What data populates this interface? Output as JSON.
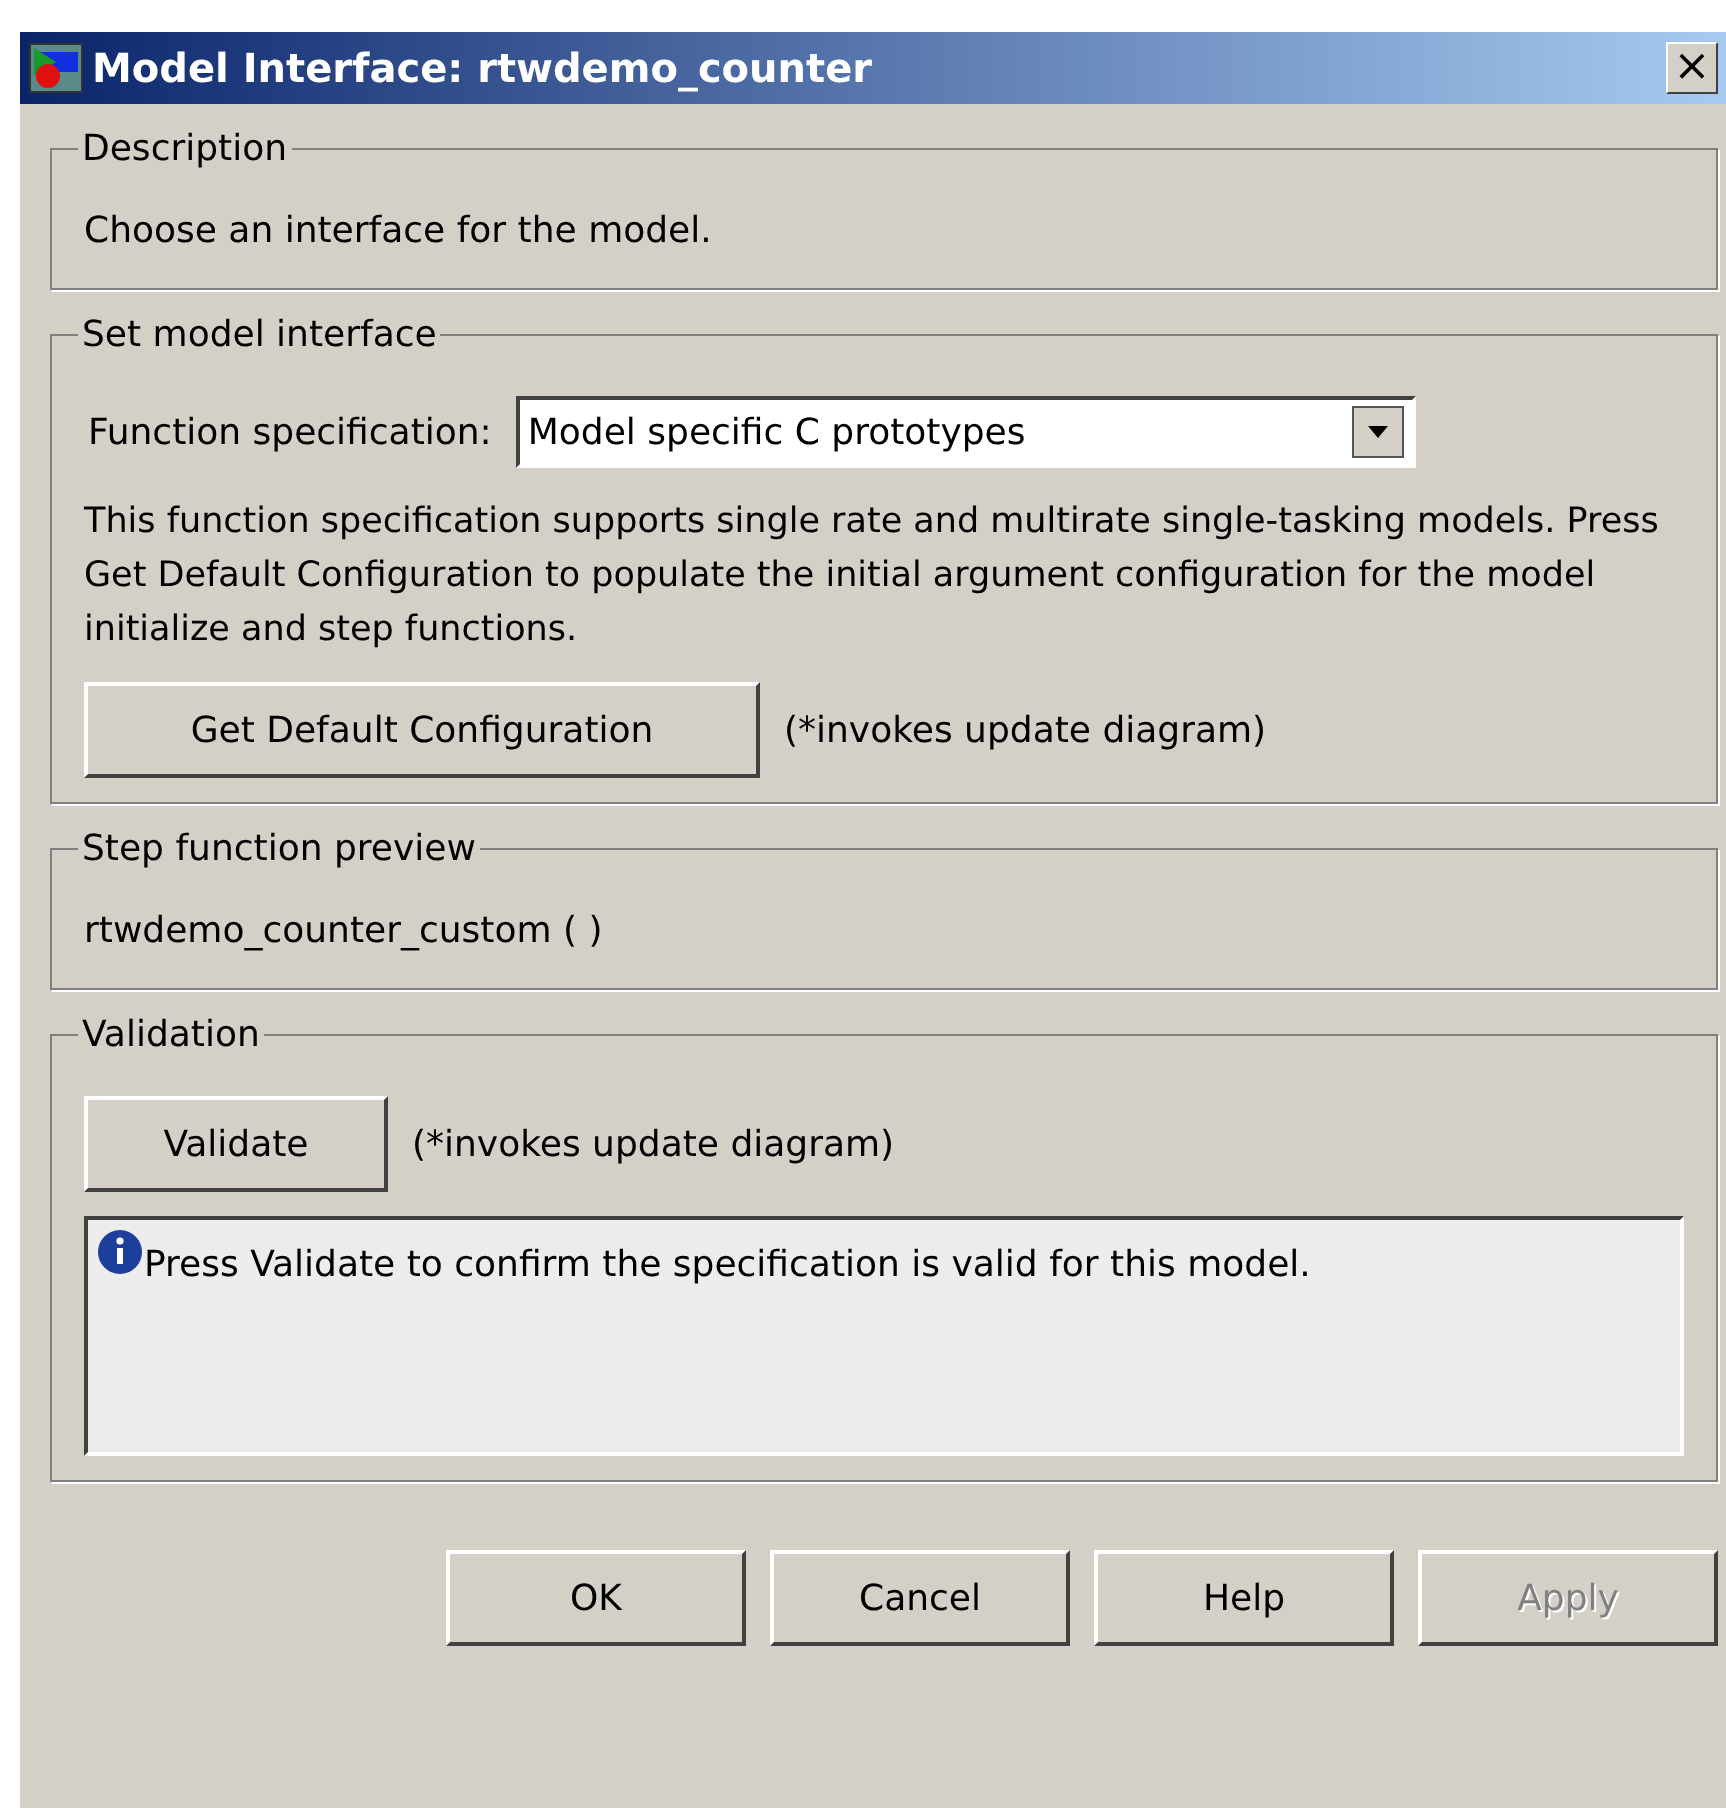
{
  "window": {
    "title": "Model Interface: rtwdemo_counter",
    "close": "×"
  },
  "description": {
    "title": "Description",
    "text": "Choose an interface for the model."
  },
  "interface": {
    "title": "Set model interface",
    "label": "Function specification:",
    "value": "Model specific C prototypes",
    "info": "This function specification supports single rate and multirate single-tasking models. Press Get Default Configuration to populate the initial argument configuration for the model initialize and step functions.",
    "button": "Get Default Configuration",
    "note": "(*invokes update diagram)"
  },
  "preview": {
    "title": "Step function preview",
    "text": "rtwdemo_counter_custom ( )"
  },
  "validation": {
    "title": "Validation",
    "button": "Validate",
    "note": "(*invokes update diagram)",
    "message": "Press Validate to confirm the specification is valid for this model."
  },
  "buttons": [
    {
      "label": "OK",
      "disabled": false
    },
    {
      "label": "Cancel",
      "disabled": false
    },
    {
      "label": "Help",
      "disabled": false
    },
    {
      "label": "Apply",
      "disabled": true
    }
  ]
}
